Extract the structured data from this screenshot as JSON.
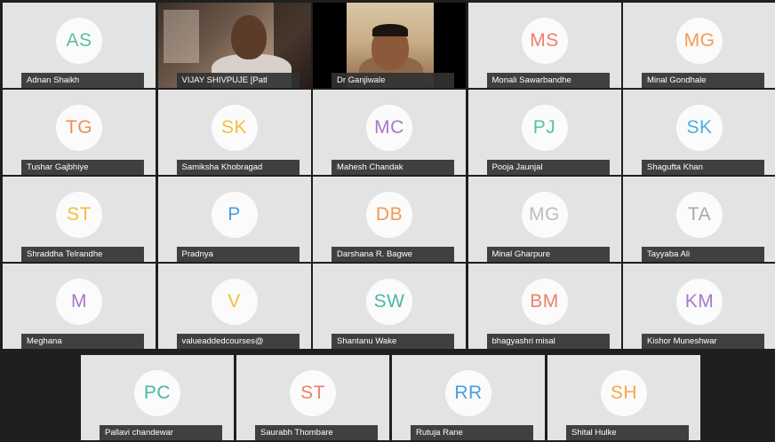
{
  "participants": [
    {
      "initials": "AS",
      "name": "Adnan Shaikh",
      "color": "#5bbf9f"
    },
    {
      "initials": "",
      "name": "VIJAY SHIVPUJE [Patl",
      "color": ""
    },
    {
      "initials": "",
      "name": "Dr Ganjiwale",
      "color": ""
    },
    {
      "initials": "MS",
      "name": "Monali Sawarbandhe",
      "color": "#f07f6a"
    },
    {
      "initials": "MG",
      "name": "Minal Gondhale",
      "color": "#f59a56"
    },
    {
      "initials": "TG",
      "name": "Tushar Gajbhiye",
      "color": "#f58c4e"
    },
    {
      "initials": "SK",
      "name": "Samiksha Khobragad",
      "color": "#f5c040"
    },
    {
      "initials": "MC",
      "name": "Mahesh Chandak",
      "color": "#a878c9"
    },
    {
      "initials": "PJ",
      "name": "Pooja Jaunjal",
      "color": "#5bbfaa"
    },
    {
      "initials": "SK",
      "name": "Shagufta Khan",
      "color": "#4ab0e0"
    },
    {
      "initials": "ST",
      "name": "Shraddha Telrandhe",
      "color": "#f5bd3a"
    },
    {
      "initials": "P",
      "name": "Pradnya",
      "color": "#4a9ee0"
    },
    {
      "initials": "DB",
      "name": "Darshana R. Bagwe",
      "color": "#f09a56"
    },
    {
      "initials": "MG",
      "name": "Minal Gharpure",
      "color": "#bdbdbd"
    },
    {
      "initials": "TA",
      "name": "Tayyaba Ali",
      "color": "#aaaaaa"
    },
    {
      "initials": "M",
      "name": "Meghana",
      "color": "#a878c9"
    },
    {
      "initials": "V",
      "name": "valueaddedcourses@",
      "color": "#f5bd3a"
    },
    {
      "initials": "SW",
      "name": "Shantanu Wake",
      "color": "#4ab8a5"
    },
    {
      "initials": "BM",
      "name": "bhagyashri misal",
      "color": "#f07f6a"
    },
    {
      "initials": "KM",
      "name": "Kishor Muneshwar",
      "color": "#a878c9"
    }
  ],
  "bottom_row": [
    {
      "initials": "PC",
      "name": "Pallavi chandewar",
      "color": "#4ab8a5"
    },
    {
      "initials": "ST",
      "name": "Saurabh Thombare",
      "color": "#f07f6a"
    },
    {
      "initials": "RR",
      "name": "Rutuja Rane",
      "color": "#4a9ee0"
    },
    {
      "initials": "SH",
      "name": "Shital Hulke",
      "color": "#f5a84a"
    }
  ]
}
